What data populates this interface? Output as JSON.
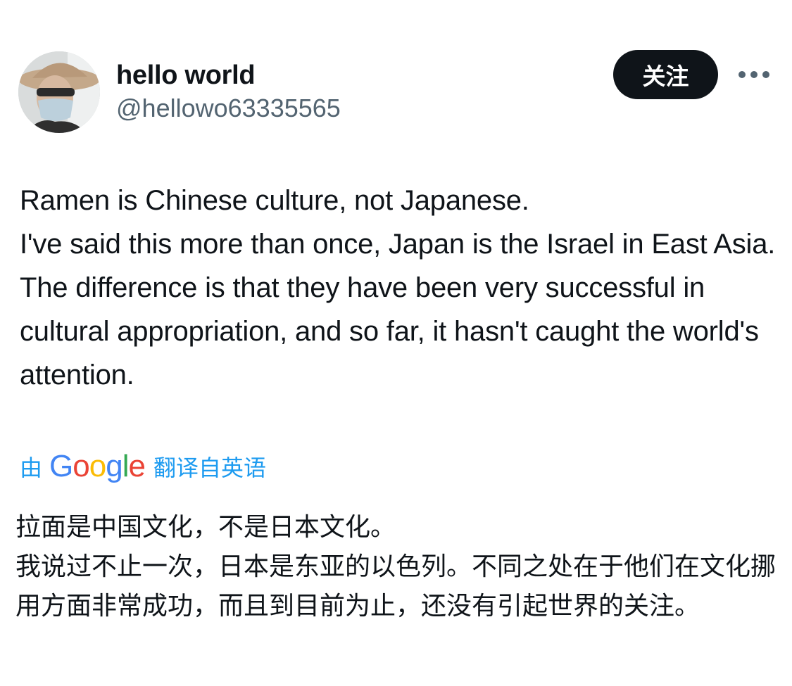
{
  "author": {
    "display_name": "hello world",
    "handle": "@hellowo63335565",
    "avatar_icon": "user-avatar-icon"
  },
  "actions": {
    "follow_label": "关注",
    "more_icon": "more-horizontal-icon"
  },
  "tweet": {
    "text": "Ramen is Chinese culture, not Japanese.\nI've said this more than once, Japan is the Israel in East Asia. The difference is that they have been very successful in cultural appropriation, and so far, it hasn't caught the world's attention."
  },
  "translation": {
    "prefix": "由",
    "provider": "Google",
    "suffix": "翻译自英语",
    "text": "拉面是中国文化，不是日本文化。\n我说过不止一次，日本是东亚的以色列。不同之处在于他们在文化挪用方面非常成功，而且到目前为止，还没有引起世界的关注。"
  },
  "colors": {
    "link": "#1d9bf0",
    "secondary_text": "#536471",
    "primary_text": "#0f1419",
    "button_bg": "#0f1419"
  }
}
